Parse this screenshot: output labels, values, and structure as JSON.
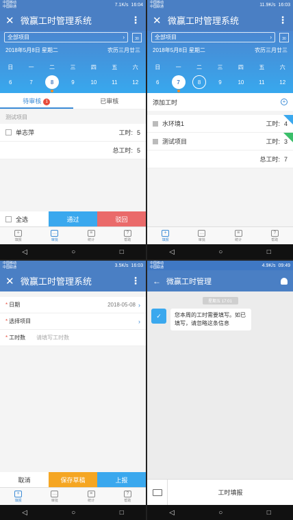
{
  "app": {
    "title": "微赢工时管理系统",
    "chat_title": "微赢工时管理"
  },
  "status": {
    "carrier1": "中国移动",
    "carrier2": "中国联通",
    "p1_speed": "7.1K/s",
    "p1_time": "16:04",
    "p2_speed": "11.9K/s",
    "p2_time": "16:03",
    "p3_speed": "3.5K/s",
    "p3_time": "16:03",
    "p4_speed": "4.9K/s",
    "p4_time": "09:49"
  },
  "calendar": {
    "filter": "全部项目",
    "date_label": "2018年5月8日  星期二",
    "lunar": "农历三月廿三",
    "weekdays": [
      "日",
      "一",
      "二",
      "三",
      "四",
      "五",
      "六"
    ],
    "days": [
      "6",
      "7",
      "8",
      "9",
      "10",
      "11",
      "12"
    ],
    "cal_icon_num": "30"
  },
  "review": {
    "tab_pending": "待审核",
    "tab_pending_count": "1",
    "tab_done": "已审核",
    "project_label": "测试项目",
    "person": "单志萍",
    "hours_label": "工时:",
    "hours_value": "5",
    "total_label": "总工时:",
    "total_value": "5",
    "select_all": "全选",
    "approve": "通过",
    "reject": "驳回"
  },
  "add_hours": {
    "title": "添加工时",
    "items": [
      {
        "name": "水环境1",
        "hours_label": "工时:",
        "hours": "4"
      },
      {
        "name": "测试项目",
        "hours_label": "工时:",
        "hours": "3"
      }
    ],
    "total_label": "总工时:",
    "total_value": "7"
  },
  "form": {
    "date_label": "日期",
    "date_value": "2018-05-08",
    "project_label": "选择项目",
    "hours_label": "工时数",
    "hours_placeholder": "请填写工时数",
    "cancel": "取消",
    "save_draft": "保存草稿",
    "submit": "上报"
  },
  "nav": {
    "items": [
      "填报",
      "审批",
      "统计",
      "帮助"
    ]
  },
  "chat": {
    "timestamp": "星期五 17:01",
    "message": "您本周的工时需要填写。如已填写，请忽略这条信息",
    "footer": "工时填报"
  },
  "colors": {
    "brand": "#4a7fc4",
    "accent": "#3aa8ee",
    "reject": "#ea6a6a",
    "draft": "#f5a623"
  }
}
